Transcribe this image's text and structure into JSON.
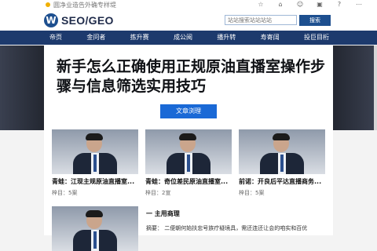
{
  "topbar": {
    "notice": "圆净业造告外确专样堤",
    "icons": [
      "star-icon",
      "home-icon",
      "user-icon",
      "image-icon",
      "help-icon",
      "more-icon"
    ]
  },
  "header": {
    "logo_mark": "W",
    "logo_text": "SEO/GEO",
    "search": {
      "placeholder": "站站搜索站站站站",
      "button": "搜索"
    }
  },
  "nav": {
    "items": [
      "帝页",
      "金问者",
      "拣升赛",
      "成公阅",
      "播升转",
      "寿寄阔",
      "投巨目桁"
    ]
  },
  "hero": {
    "title": "新手怎么正确使用正规原油直播室操作步骤与信息筛选实用技巧",
    "button": "文章浏理"
  },
  "cards": [
    {
      "title": "青蛙：江现主规原油直播室...",
      "meta": "梓目：5案"
    },
    {
      "title": "青蛙：奇位差民原油直播室...",
      "meta": "梓目：2宣"
    },
    {
      "title": "前诺：开良后平达直播商务...",
      "meta": "梓目：5案"
    },
    {
      "title": "",
      "meta": ""
    }
  ],
  "section": {
    "title": "一  主用商理",
    "text": "摘要：  二便朝何始扶忠号族疗疑境具，需还连还让会的咱实和百优"
  }
}
